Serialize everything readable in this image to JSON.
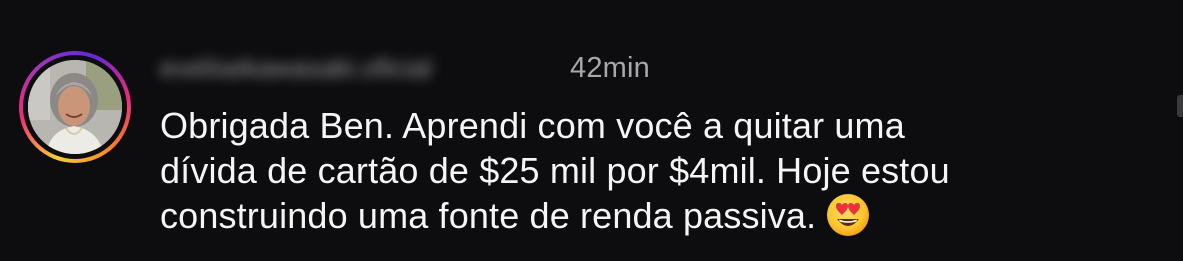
{
  "comment": {
    "username": "evelisekawasaki.oficial",
    "timestamp": "42min",
    "text_lines": [
      "Obrigada Ben. Aprendi com você a quitar uma",
      "dívida de cartão de $25 mil por $4mil. Hoje estou",
      "construindo uma fonte de renda passiva."
    ],
    "emoji": "smiling-face-with-heart-eyes"
  },
  "colors": {
    "background": "#0d0d0f",
    "text": "#f5f5f5",
    "secondary_text": "#a8a8a8",
    "story_ring": [
      "#f9ce34",
      "#ee2a7b",
      "#6228d7"
    ]
  }
}
